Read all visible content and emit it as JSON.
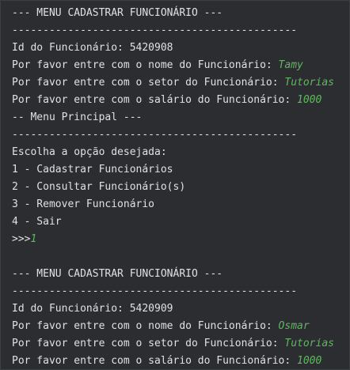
{
  "console": {
    "lines": [
      {
        "text": "--- MENU CADASTRAR FUNCIONÁRIO ---",
        "input": ""
      },
      {
        "text": "----------------------------------------------",
        "input": ""
      },
      {
        "text": "Id do Funcionário: 5420908",
        "input": ""
      },
      {
        "text": "Por favor entre com o nome do Funcionário: ",
        "input": "Tamy"
      },
      {
        "text": "Por favor entre com o setor do Funcionário: ",
        "input": "Tutorias"
      },
      {
        "text": "Por favor entre com o salário do Funcionário: ",
        "input": "1000"
      },
      {
        "text": "-- Menu Principal ---",
        "input": ""
      },
      {
        "text": "----------------------------------------------",
        "input": ""
      },
      {
        "text": "Escolha a opção desejada:",
        "input": ""
      },
      {
        "text": "1 - Cadastrar Funcionários",
        "input": ""
      },
      {
        "text": "2 - Consultar Funcionário(s)",
        "input": ""
      },
      {
        "text": "3 - Remover Funcionário",
        "input": ""
      },
      {
        "text": "4 - Sair",
        "input": ""
      },
      {
        "text": ">>>",
        "input": "1"
      },
      {
        "text": "",
        "input": ""
      },
      {
        "text": "--- MENU CADASTRAR FUNCIONÁRIO ---",
        "input": ""
      },
      {
        "text": "----------------------------------------------",
        "input": ""
      },
      {
        "text": "Id do Funcionário: 5420909",
        "input": ""
      },
      {
        "text": "Por favor entre com o nome do Funcionário: ",
        "input": "Osmar"
      },
      {
        "text": "Por favor entre com o setor do Funcionário: ",
        "input": "Tutorias"
      },
      {
        "text": "Por favor entre com o salário do Funcionário: ",
        "input": "1000"
      }
    ]
  },
  "colors": {
    "background": "#2b2d30",
    "text": "#dfe1e5",
    "user_input": "#5fb85f"
  }
}
